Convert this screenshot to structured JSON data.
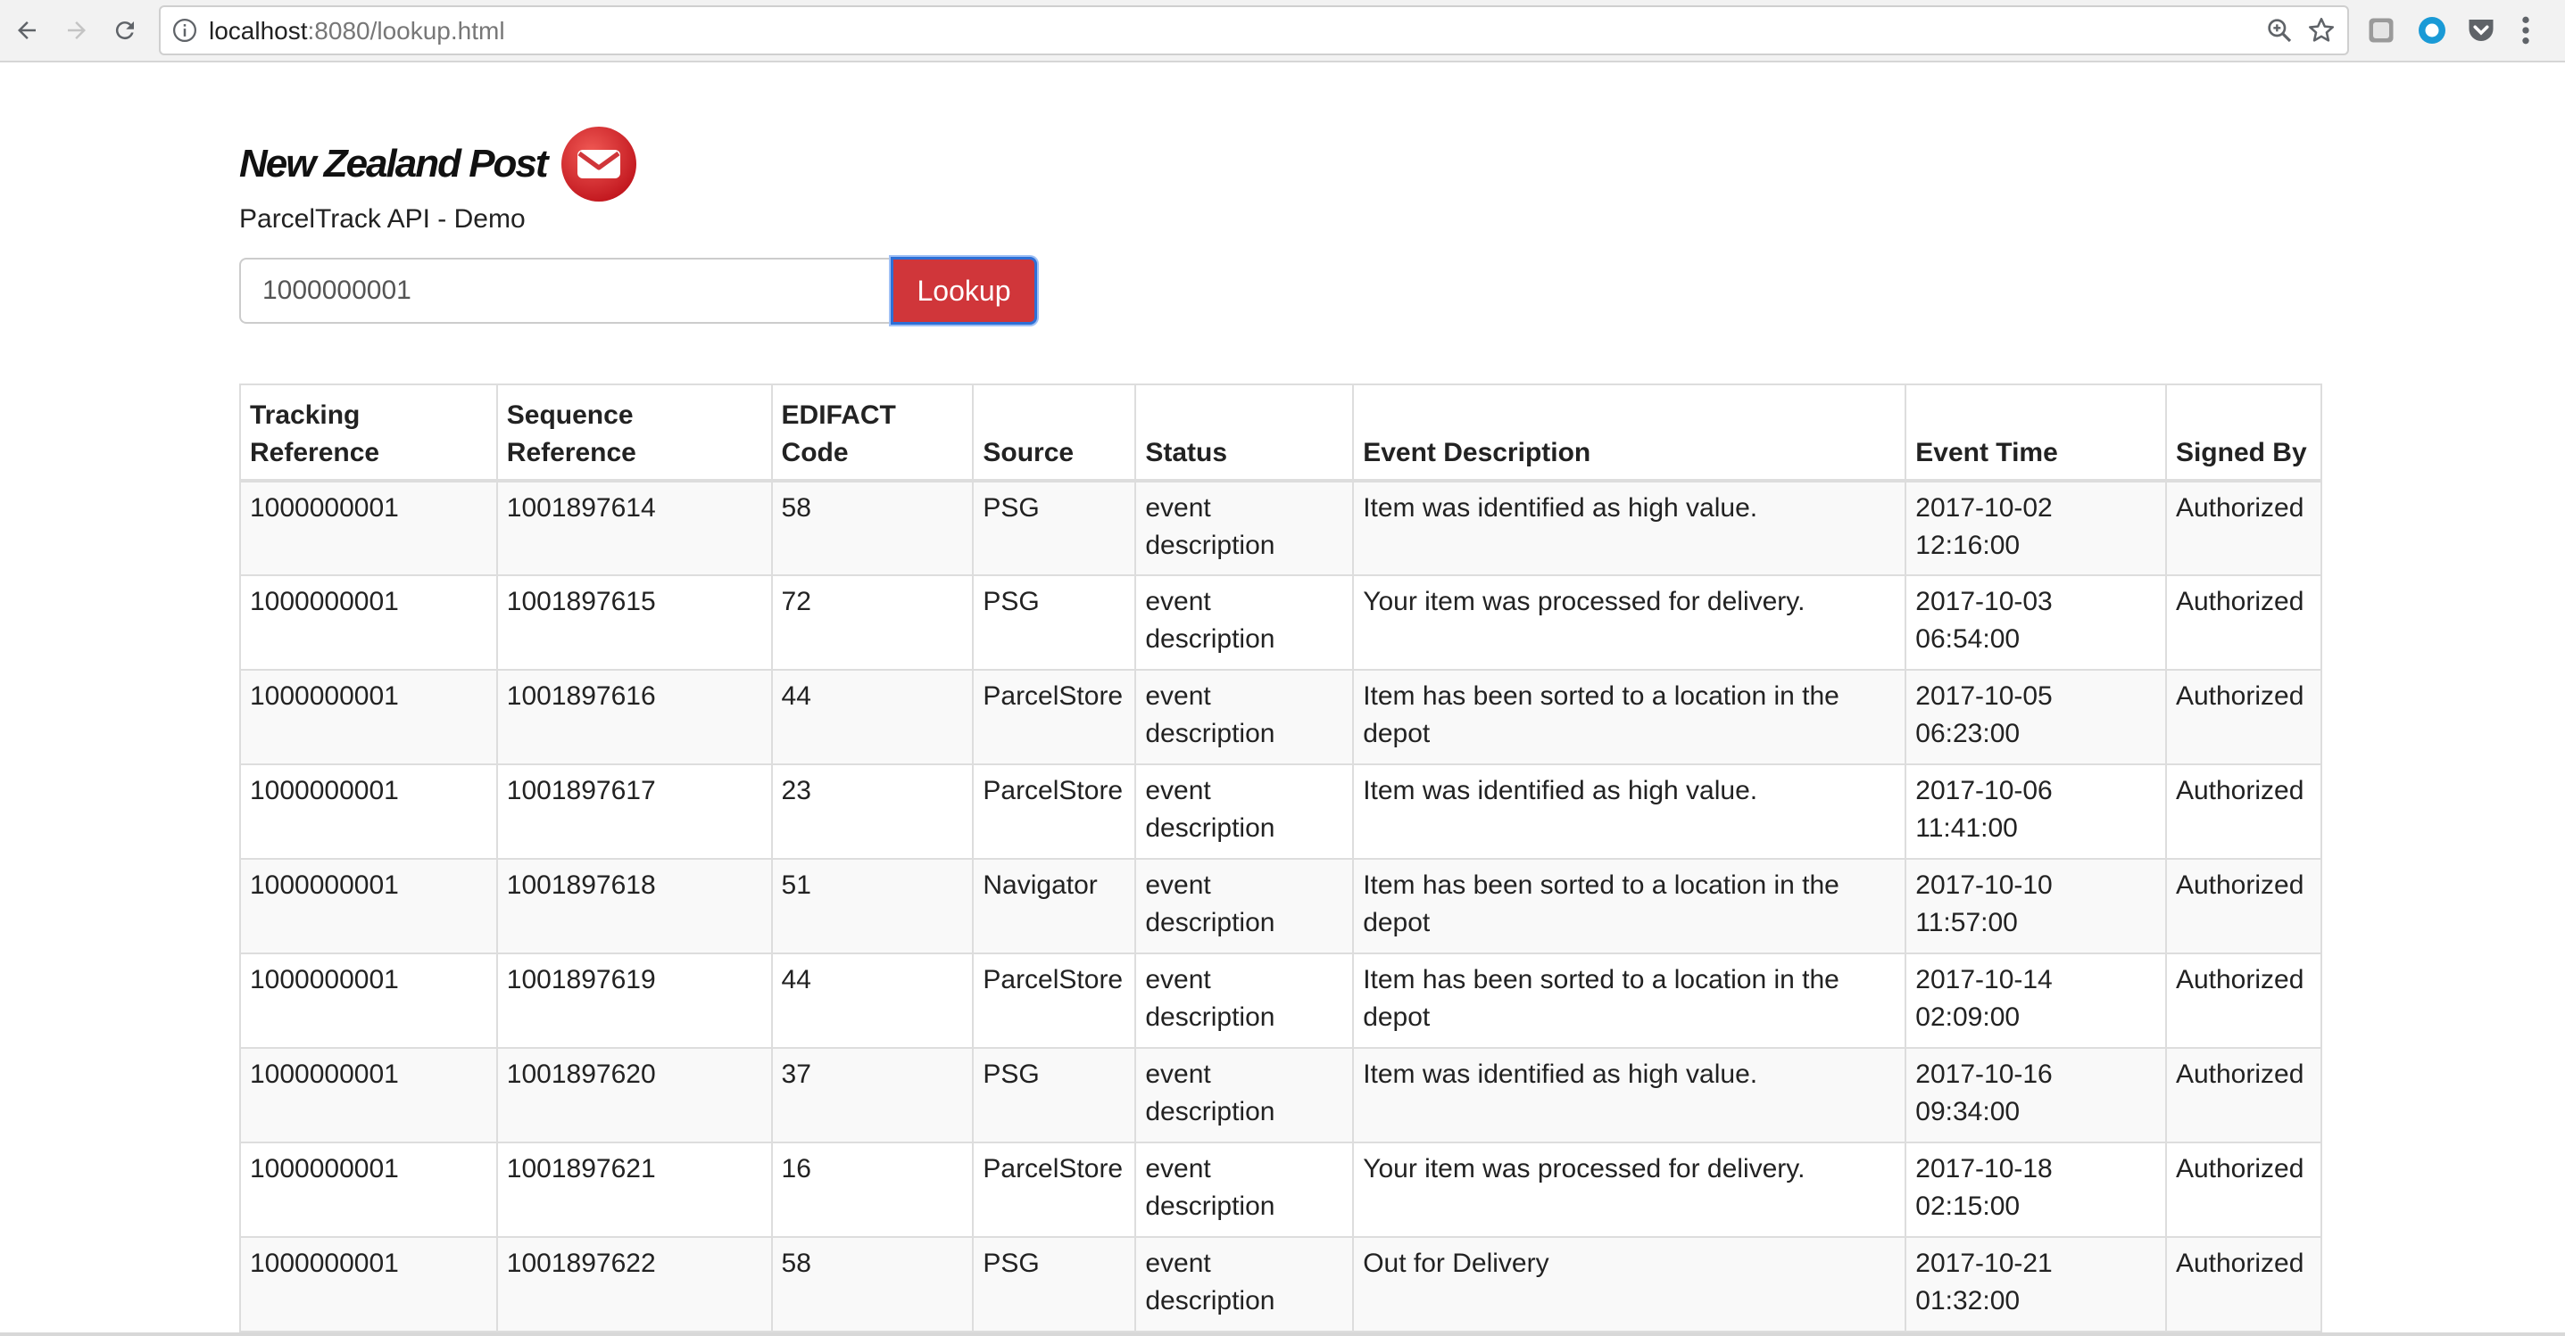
{
  "browser": {
    "url_host": "localhost",
    "url_rest": ":8080/lookup.html",
    "icons": [
      "back-arrow-icon",
      "forward-arrow-icon",
      "reload-icon",
      "info-icon",
      "zoom-icon",
      "bookmark-star-icon",
      "extension-icon",
      "circle-extension-icon",
      "pocket-icon",
      "menu-dots-icon"
    ]
  },
  "brand": {
    "logo_text": "New Zealand Post",
    "subtitle": "ParcelTrack API - Demo",
    "accent_color": "#d0363a"
  },
  "lookup": {
    "value": "1000000001",
    "button_label": "Lookup"
  },
  "table": {
    "headers": [
      [
        "Tracking",
        "Reference"
      ],
      [
        "Sequence",
        "Reference"
      ],
      [
        "EDIFACT",
        "Code"
      ],
      [
        "Source"
      ],
      [
        "Status"
      ],
      [
        "Event Description"
      ],
      [
        "Event Time"
      ],
      [
        "Signed By"
      ]
    ],
    "rows": [
      [
        "1000000001",
        "1001897614",
        "58",
        "PSG",
        "event description",
        "Item was identified as high value.",
        "2017-10-02 12:16:00",
        "Authorized"
      ],
      [
        "1000000001",
        "1001897615",
        "72",
        "PSG",
        "event description",
        "Your item was processed for delivery.",
        "2017-10-03 06:54:00",
        "Authorized"
      ],
      [
        "1000000001",
        "1001897616",
        "44",
        "ParcelStore",
        "event description",
        "Item has been sorted to a location in the depot",
        "2017-10-05 06:23:00",
        "Authorized"
      ],
      [
        "1000000001",
        "1001897617",
        "23",
        "ParcelStore",
        "event description",
        "Item was identified as high value.",
        "2017-10-06 11:41:00",
        "Authorized"
      ],
      [
        "1000000001",
        "1001897618",
        "51",
        "Navigator",
        "event description",
        "Item has been sorted to a location in the depot",
        "2017-10-10 11:57:00",
        "Authorized"
      ],
      [
        "1000000001",
        "1001897619",
        "44",
        "ParcelStore",
        "event description",
        "Item has been sorted to a location in the depot",
        "2017-10-14 02:09:00",
        "Authorized"
      ],
      [
        "1000000001",
        "1001897620",
        "37",
        "PSG",
        "event description",
        "Item was identified as high value.",
        "2017-10-16 09:34:00",
        "Authorized"
      ],
      [
        "1000000001",
        "1001897621",
        "16",
        "ParcelStore",
        "event description",
        "Your item was processed for delivery.",
        "2017-10-18 02:15:00",
        "Authorized"
      ],
      [
        "1000000001",
        "1001897622",
        "58",
        "PSG",
        "event description",
        "Out for Delivery",
        "2017-10-21 01:32:00",
        "Authorized"
      ]
    ]
  }
}
